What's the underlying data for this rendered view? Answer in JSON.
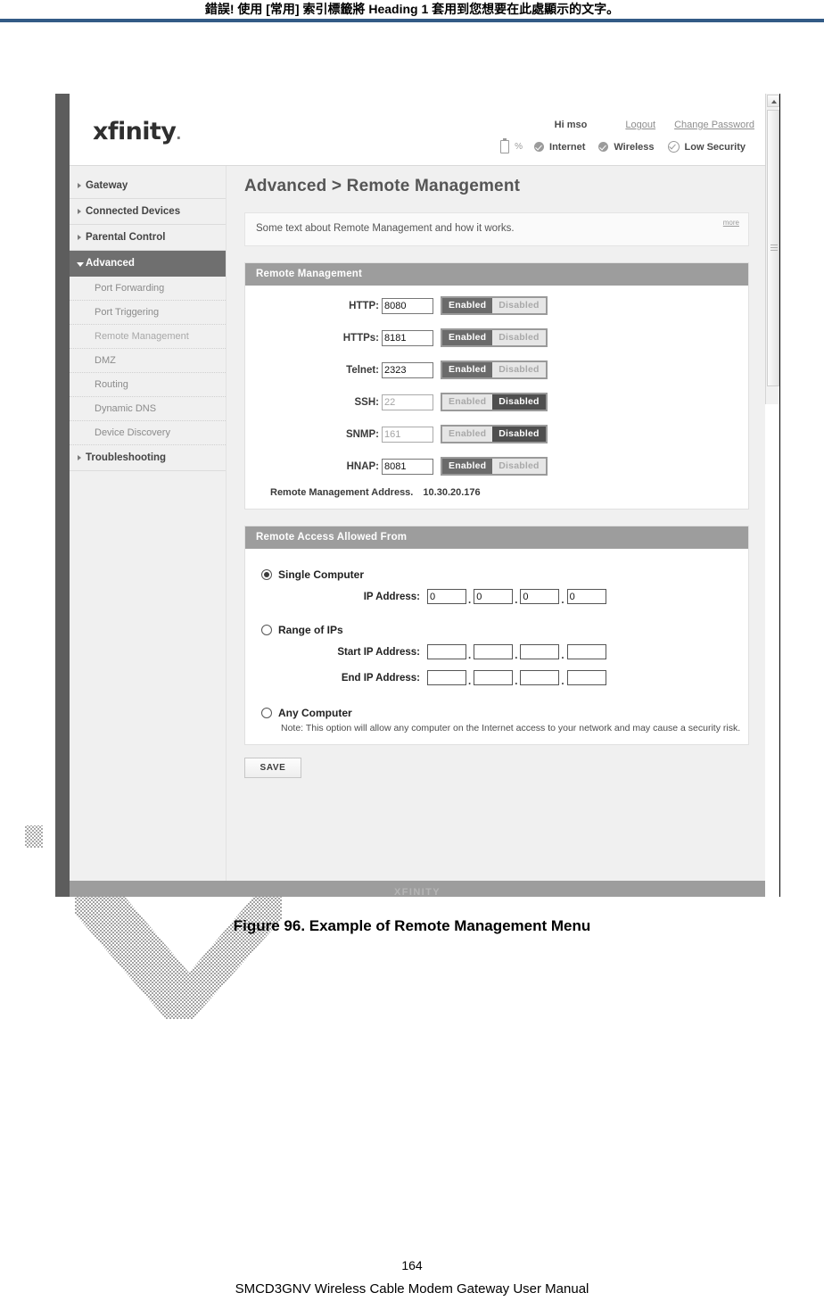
{
  "document": {
    "header_note": "錯誤! 使用 [常用] 索引標籤將 Heading 1 套用到您想要在此處顯示的文字。",
    "figure_caption": "Figure 96. Example of Remote Management Menu",
    "page_number": "164",
    "footer": "SMCD3GNV Wireless Cable Modem Gateway User Manual"
  },
  "router": {
    "brand": "xfinity",
    "account": {
      "greeting": "Hi mso",
      "logout": "Logout",
      "change_password": "Change Password"
    },
    "status": {
      "battery_percent": "%",
      "internet": "Internet",
      "wireless": "Wireless",
      "security": "Low Security"
    },
    "sidebar": {
      "items": [
        {
          "label": "Gateway",
          "type": "top",
          "active": false
        },
        {
          "label": "Connected Devices",
          "type": "top",
          "active": false
        },
        {
          "label": "Parental Control",
          "type": "top",
          "active": false
        },
        {
          "label": "Advanced",
          "type": "top",
          "active": true
        }
      ],
      "sub_items": [
        {
          "label": "Port Forwarding"
        },
        {
          "label": "Port Triggering"
        },
        {
          "label": "Remote Management"
        },
        {
          "label": "DMZ"
        },
        {
          "label": "Routing"
        },
        {
          "label": "Dynamic DNS"
        },
        {
          "label": "Device Discovery"
        }
      ],
      "last_item": {
        "label": "Troubleshooting"
      }
    },
    "page": {
      "title": "Advanced > Remote Management",
      "intro_text": "Some text about Remote Management and how it works.",
      "more_label": "more"
    },
    "remote_management": {
      "panel_title": "Remote Management",
      "enabled_label": "Enabled",
      "disabled_label": "Disabled",
      "rows": [
        {
          "label": "HTTP:",
          "port": "8080",
          "state": "enabled"
        },
        {
          "label": "HTTPs:",
          "port": "8181",
          "state": "enabled"
        },
        {
          "label": "Telnet:",
          "port": "2323",
          "state": "enabled"
        },
        {
          "label": "SSH:",
          "port": "22",
          "state": "disabled"
        },
        {
          "label": "SNMP:",
          "port": "161",
          "state": "disabled"
        },
        {
          "label": "HNAP:",
          "port": "8081",
          "state": "enabled"
        }
      ],
      "address_label": "Remote Management Address.",
      "address_value": "10.30.20.176"
    },
    "remote_access": {
      "panel_title": "Remote Access Allowed From",
      "options": [
        {
          "label": "Single Computer",
          "selected": true
        },
        {
          "label": "Range of IPs",
          "selected": false
        },
        {
          "label": "Any Computer",
          "selected": false
        }
      ],
      "single_ip_label": "IP Address:",
      "single_ip": [
        "0",
        "0",
        "0",
        "0"
      ],
      "start_ip_label": "Start IP Address:",
      "start_ip": [
        "",
        "",
        "",
        ""
      ],
      "end_ip_label": "End IP Address:",
      "end_ip": [
        "",
        "",
        "",
        ""
      ],
      "any_note": "Note: This option will allow any computer on the Internet access to your network and may cause a security risk."
    },
    "save_label": "SAVE",
    "footer_cut": "XFINITY"
  }
}
